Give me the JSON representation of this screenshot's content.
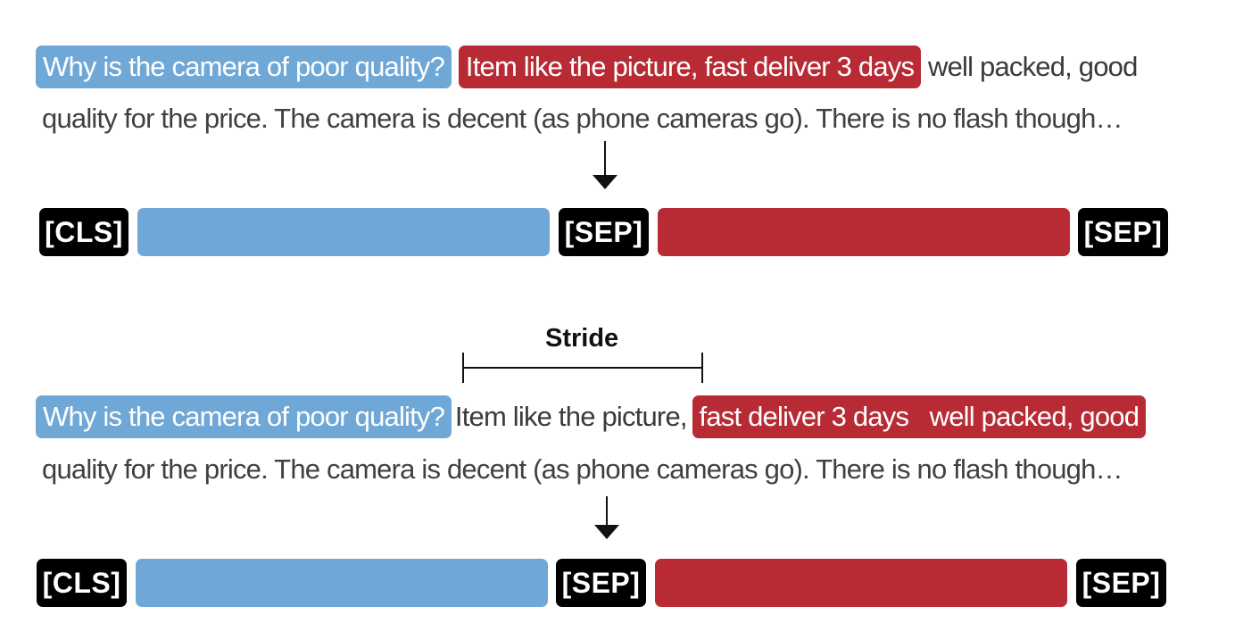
{
  "top": {
    "question": "Why is the camera of poor quality?",
    "context_highlight": "Item like the picture, fast deliver 3 days",
    "context_rest_line1": "well packed, good",
    "context_line2": "quality for the price. The camera is decent (as phone cameras go). There is no flash though…",
    "tokens": {
      "cls": "[CLS]",
      "sep1": "[SEP]",
      "sep2": "[SEP]"
    }
  },
  "stride": {
    "label": "Stride"
  },
  "bottom": {
    "question": "Why is the camera of poor quality?",
    "context_plain": "Item like the picture,",
    "context_highlight": "fast deliver 3 days   well packed, good",
    "context_line2": "quality for the price. The camera is decent (as phone cameras go). There is no flash though…",
    "tokens": {
      "cls": "[CLS]",
      "sep1": "[SEP]",
      "sep2": "[SEP]"
    }
  },
  "colors": {
    "question": "#6fa8d6",
    "context": "#b82b35",
    "special_token": "#000000"
  }
}
